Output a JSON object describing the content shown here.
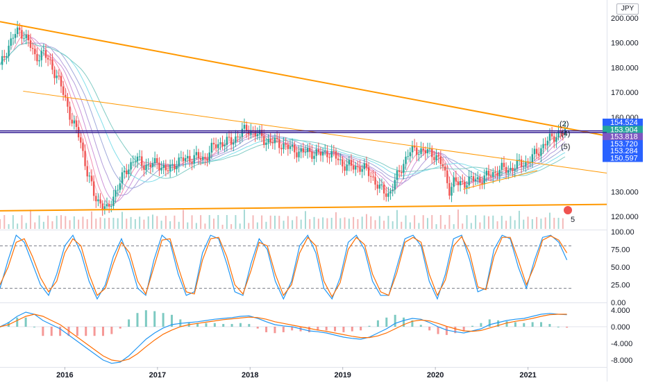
{
  "currency": "JPY",
  "colors": {
    "bull": "#26a69a",
    "bear": "#ef5350",
    "trend": "#ff9800",
    "level": "#311b92",
    "k_line": "#2196f3",
    "d_line": "#ff6d00",
    "vol_up": "#80cbc4",
    "vol_down": "#ef9a9a",
    "annotation": "#2196f3"
  },
  "chart_data": [
    {
      "type": "candlestick",
      "title": "",
      "ylim": [
        115,
        205
      ],
      "x_ticks": [
        "2016",
        "2017",
        "2018",
        "2019",
        "2020",
        "2021"
      ],
      "y_ticks": [
        "200.000",
        "190.000",
        "180.000",
        "170.000",
        "160.000",
        "130.000",
        "120.000"
      ],
      "x_tick_years": [
        2016.0,
        2017.0,
        2018.0,
        2019.0,
        2020.0,
        2021.0
      ],
      "y_tick_values": [
        200,
        190,
        180,
        170,
        160,
        130,
        120
      ],
      "xlim": [
        2015.3,
        2021.85
      ],
      "close_series": {
        "x": [
          2015.3,
          2015.38,
          2015.45,
          2015.52,
          2015.6,
          2015.68,
          2015.76,
          2015.84,
          2015.92,
          2016.0,
          2016.08,
          2016.16,
          2016.24,
          2016.32,
          2016.4,
          2016.46,
          2016.52,
          2016.6,
          2016.68,
          2016.76,
          2016.82,
          2016.9,
          2017.0,
          2017.1,
          2017.2,
          2017.3,
          2017.4,
          2017.5,
          2017.6,
          2017.7,
          2017.8,
          2017.9,
          2018.0,
          2018.08,
          2018.15,
          2018.25,
          2018.35,
          2018.45,
          2018.55,
          2018.65,
          2018.75,
          2018.85,
          2018.95,
          2019.0,
          2019.1,
          2019.2,
          2019.3,
          2019.4,
          2019.5,
          2019.6,
          2019.66,
          2019.72,
          2019.8,
          2019.9,
          2020.0,
          2020.08,
          2020.15,
          2020.2,
          2020.25,
          2020.33,
          2020.42,
          2020.5,
          2020.6,
          2020.7,
          2020.8,
          2020.9,
          2021.0,
          2021.1,
          2021.2,
          2021.3,
          2021.4
        ],
        "y": [
          180,
          188,
          193,
          195,
          191,
          184,
          186,
          182,
          176,
          168,
          158,
          152,
          138,
          128,
          125,
          122,
          128,
          134,
          140,
          143,
          142,
          140,
          142,
          138,
          142,
          143,
          144,
          143,
          148,
          150,
          150,
          154,
          155,
          153,
          151,
          150,
          149,
          147,
          146,
          146,
          145,
          146,
          143,
          141,
          140,
          140,
          137,
          131,
          129,
          137,
          142,
          146,
          147,
          146,
          145,
          140,
          131,
          134,
          133,
          134,
          135,
          135,
          137,
          139,
          139,
          141,
          142,
          146,
          150,
          153,
          153.9
        ]
      },
      "trendlines": [
        {
          "x": [
            2015.3,
            2021.85
          ],
          "y": [
            198.5,
            152.5
          ]
        },
        {
          "x": [
            2015.3,
            2021.85
          ],
          "y": [
            122.3,
            124.9
          ]
        },
        {
          "x": [
            2015.55,
            2021.85
          ],
          "y": [
            170.5,
            137.5
          ]
        },
        {
          "x": [
            2020.3,
            2021.1
          ],
          "y": [
            131,
            138.5
          ]
        }
      ],
      "horizontal_levels": [
        {
          "value": 154.524,
          "color": "#2962ff"
        },
        {
          "value": 153.904,
          "color": "#26a69a"
        },
        {
          "value": 153.818,
          "color": "#7e57c2"
        },
        {
          "value": 153.72,
          "color": "#2962ff"
        },
        {
          "value": 153.284,
          "color": "#2962ff"
        },
        {
          "value": 150.597,
          "color": "#2962ff"
        }
      ],
      "price_badges": [
        "154.524",
        "153.904",
        "153.818",
        "153.720",
        "153.284",
        "150.597"
      ],
      "annotations": [
        "(2)",
        "(4)",
        "(5)",
        "5"
      ]
    },
    {
      "type": "line",
      "title": "",
      "ylim": [
        0,
        100
      ],
      "y_ticks": [
        "100.00",
        "75.00",
        "50.00",
        "25.00",
        "0.00"
      ],
      "y_tick_values": [
        100,
        75,
        50,
        25,
        0
      ],
      "levels": [
        80,
        20
      ],
      "series": [
        {
          "values": [
            20,
            60,
            95,
            85,
            55,
            25,
            10,
            40,
            80,
            95,
            70,
            30,
            5,
            25,
            65,
            90,
            60,
            20,
            10,
            60,
            95,
            85,
            40,
            10,
            15,
            70,
            95,
            90,
            55,
            15,
            10,
            55,
            90,
            75,
            30,
            5,
            30,
            80,
            95,
            70,
            20,
            5,
            35,
            85,
            95,
            75,
            30,
            10,
            10,
            50,
            90,
            95,
            80,
            30,
            5,
            40,
            90,
            95,
            60,
            15,
            20,
            75,
            95,
            90,
            50,
            20,
            60,
            92,
            95,
            85,
            60
          ]
        },
        {
          "values": [
            25,
            50,
            85,
            90,
            65,
            35,
            15,
            30,
            70,
            90,
            80,
            40,
            10,
            20,
            55,
            85,
            70,
            30,
            12,
            50,
            88,
            90,
            50,
            15,
            12,
            60,
            90,
            92,
            65,
            25,
            12,
            45,
            85,
            80,
            40,
            10,
            25,
            70,
            92,
            80,
            30,
            8,
            28,
            75,
            92,
            82,
            40,
            15,
            10,
            42,
            85,
            92,
            85,
            40,
            10,
            32,
            80,
            93,
            70,
            22,
            18,
            65,
            92,
            92,
            60,
            25,
            52,
            88,
            94,
            88,
            70
          ]
        }
      ]
    },
    {
      "type": "bar",
      "title": "",
      "ylim": [
        -9.5,
        5.5
      ],
      "y_ticks": [
        "4.000",
        "0.000",
        "-4.000",
        "-8.000"
      ],
      "y_tick_values": [
        4,
        0,
        -4,
        -8
      ],
      "series": [
        {
          "values": [
            0,
            1.0,
            2.5,
            3.5,
            3.0,
            1.5,
            0.5,
            -0.5,
            -2.0,
            -3.5,
            -5.0,
            -6.5,
            -8.0,
            -8.8,
            -8.5,
            -7.0,
            -5.0,
            -3.0,
            -1.5,
            -0.3,
            0.5,
            0.8,
            1.0,
            1.2,
            1.5,
            1.8,
            2.0,
            2.2,
            2.5,
            2.6,
            2.0,
            1.2,
            0.5,
            0.2,
            0,
            -0.5,
            -1.0,
            -1.2,
            -1.5,
            -2.0,
            -2.5,
            -2.8,
            -3.0,
            -2.5,
            -1.5,
            -0.5,
            0.8,
            1.5,
            2.0,
            1.8,
            1.0,
            0,
            -0.8,
            -1.2,
            -1.5,
            -1.0,
            -0.5,
            0.5,
            1.0,
            1.5,
            1.8,
            2.0,
            2.5,
            3.0,
            3.2,
            3.0,
            2.9
          ]
        },
        {
          "values": [
            0,
            0.5,
            1.5,
            2.5,
            3.0,
            2.5,
            1.5,
            0.5,
            -1.0,
            -2.5,
            -4.0,
            -5.5,
            -7.0,
            -8.0,
            -8.3,
            -7.8,
            -6.5,
            -4.8,
            -3.2,
            -1.8,
            -0.8,
            0,
            0.5,
            0.8,
            1.1,
            1.4,
            1.7,
            1.9,
            2.1,
            2.3,
            2.2,
            1.8,
            1.2,
            0.8,
            0.4,
            0,
            -0.4,
            -0.8,
            -1.1,
            -1.5,
            -1.9,
            -2.3,
            -2.6,
            -2.6,
            -2.2,
            -1.5,
            -0.5,
            0.5,
            1.3,
            1.6,
            1.4,
            0.8,
            0.1,
            -0.5,
            -1.0,
            -1.1,
            -0.9,
            -0.3,
            0.3,
            0.9,
            1.3,
            1.6,
            2.0,
            2.5,
            2.9,
            3.0,
            3.0
          ]
        }
      ]
    }
  ]
}
